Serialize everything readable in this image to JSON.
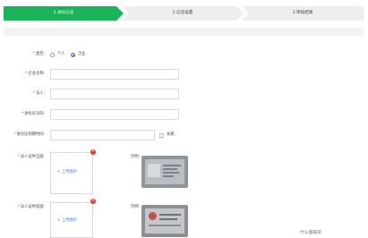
{
  "steps": [
    {
      "label": "1.身份认证",
      "active": true
    },
    {
      "label": "2.信息设置",
      "active": false
    },
    {
      "label": "3.审核结果",
      "active": false
    }
  ],
  "colors": {
    "accent": "#1ab35a",
    "required": "#e53935",
    "link": "#3a7be0"
  },
  "form": {
    "type_label": "类型:",
    "type_options": [
      {
        "label": "个人",
        "selected": false
      },
      {
        "label": "企业",
        "selected": true
      }
    ],
    "company_name_label": "企业名称:",
    "legal_person_label": "法人:",
    "id_number_label": "身份证号码:",
    "id_validity_label": "身份证到期时间:",
    "long_term_label": "长期",
    "id_front_label": "法人证件正面:",
    "id_back_label": "法人证件反面:",
    "upload_label": "+ 上传图片",
    "sample_label": "示例:",
    "remove_glyph": "×"
  },
  "watermark": "什么值得买"
}
